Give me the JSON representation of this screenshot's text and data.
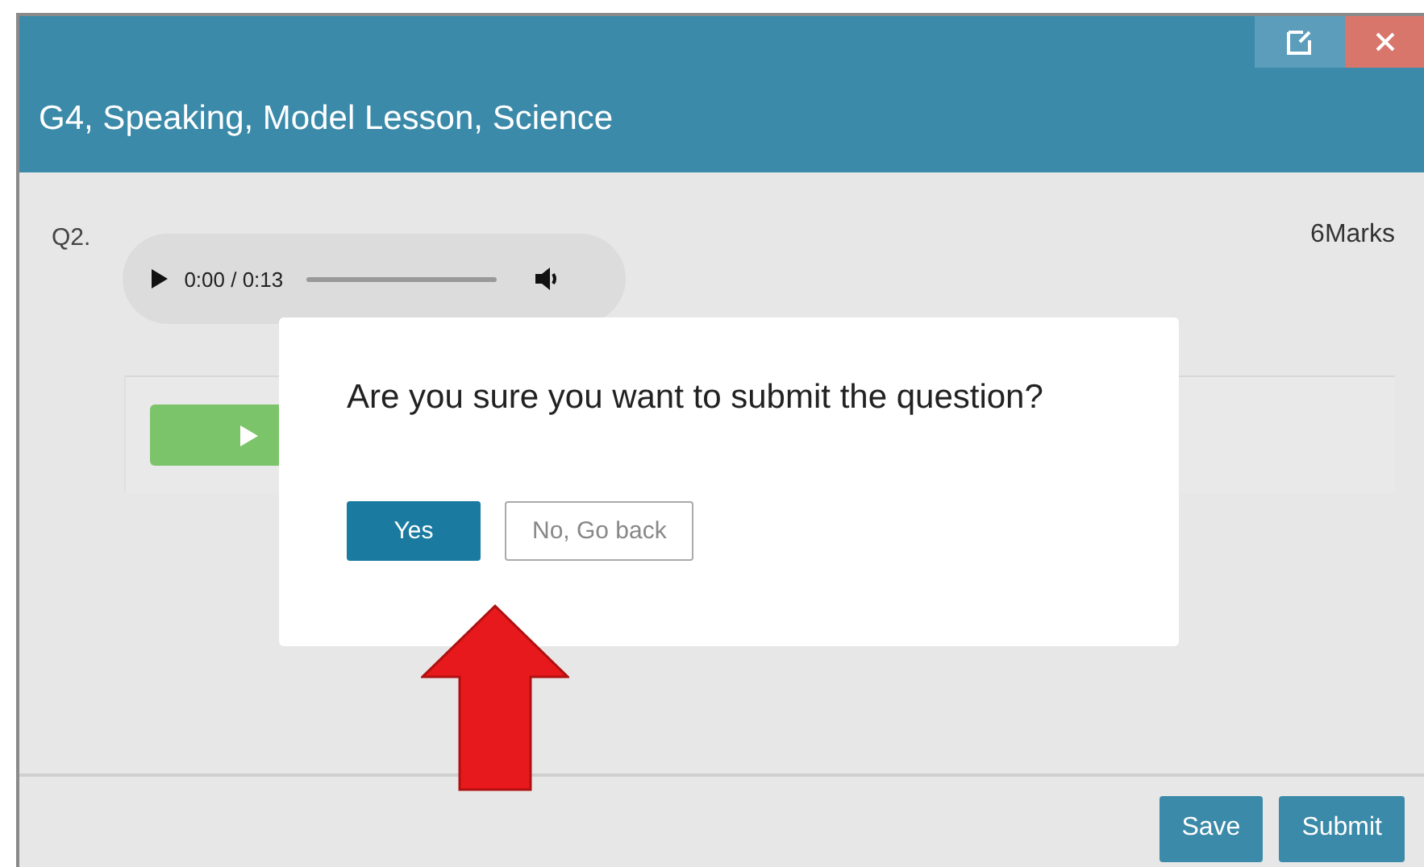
{
  "window": {
    "title": "G4, Speaking, Model Lesson, Science"
  },
  "question": {
    "number": "Q2.",
    "audio": {
      "time": "0:00 / 0:13"
    },
    "marks": "6Marks"
  },
  "dialog": {
    "message": "Are you sure you want to submit the question?",
    "buttons": [
      {
        "label": "Yes",
        "kind": "primary"
      },
      {
        "label": "No, Go back",
        "kind": "secondary"
      }
    ]
  },
  "footer": {
    "buttons": [
      {
        "label": "Save"
      },
      {
        "label": "Submit"
      }
    ]
  }
}
